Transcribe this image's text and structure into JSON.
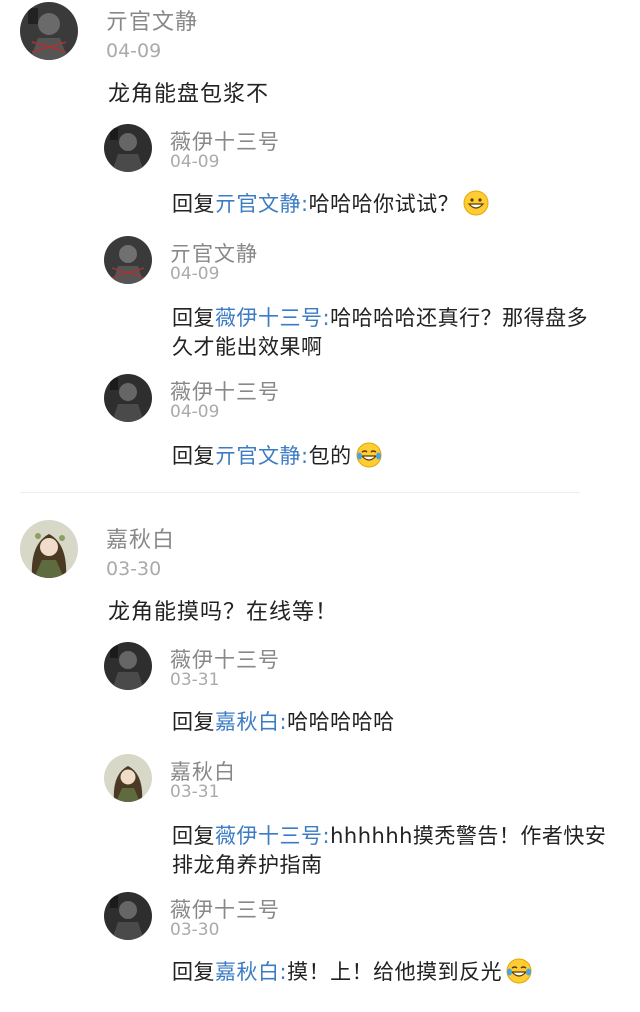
{
  "threads": [
    {
      "author": "亓官文静",
      "date": "04-09",
      "text": "龙角能盘包浆不",
      "replies": [
        {
          "author": "薇伊十三号",
          "date": "04-09",
          "prefix": "回复",
          "target": "亓官文静",
          "colon": ":",
          "text": "哈哈哈你试试？",
          "emoji": "grinning-face-icon"
        },
        {
          "author": "亓官文静",
          "date": "04-09",
          "prefix": "回复",
          "target": "薇伊十三号",
          "colon": ":",
          "text": "哈哈哈哈还真行？那得盘多",
          "text2": "久才能出效果啊"
        },
        {
          "author": "薇伊十三号",
          "date": "04-09",
          "prefix": "回复",
          "target": "亓官文静",
          "colon": ":",
          "text": "包的",
          "emoji": "tears-of-joy-icon"
        }
      ]
    },
    {
      "author": "嘉秋白",
      "date": "03-30",
      "text": "龙角能摸吗？在线等！",
      "replies": [
        {
          "author": "薇伊十三号",
          "date": "03-31",
          "prefix": "回复",
          "target": "嘉秋白",
          "colon": ":",
          "text": "哈哈哈哈哈"
        },
        {
          "author": "嘉秋白",
          "date": "03-31",
          "prefix": "回复",
          "target": "薇伊十三号",
          "colon": ":",
          "text": "hhhhhh摸秃警告！作者快安",
          "text2": "排龙角养护指南"
        },
        {
          "author": "薇伊十三号",
          "date": "03-30",
          "prefix": "回复",
          "target": "嘉秋白",
          "colon": ":",
          "text": "摸！上！给他摸到反光",
          "emoji": "tears-of-joy-icon"
        }
      ]
    }
  ],
  "colors": {
    "link": "#3b7cc4",
    "name": "#888888",
    "date": "#aaaaaa",
    "text": "#222222"
  }
}
